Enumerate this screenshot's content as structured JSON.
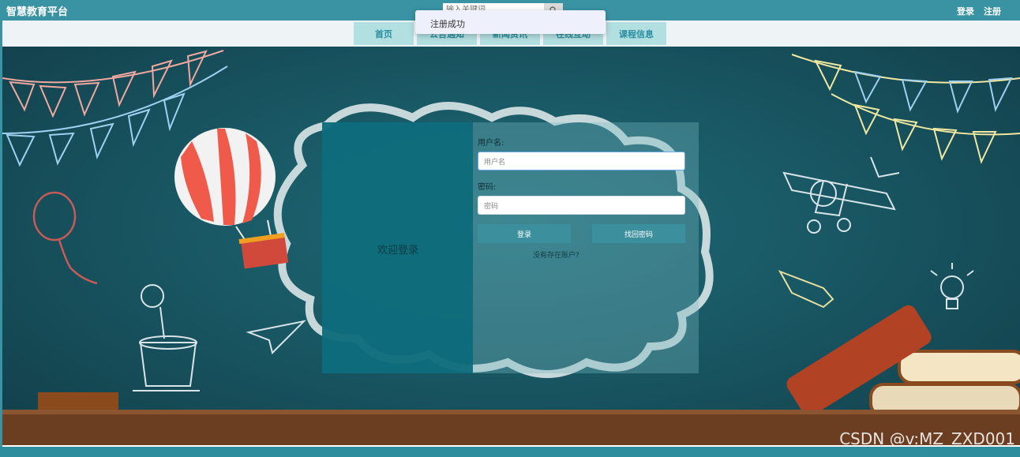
{
  "header": {
    "site_title": "智慧教育平台",
    "search_placeholder": "输入关键词",
    "login": "登录",
    "register": "注册"
  },
  "nav": {
    "items": [
      {
        "label": "首页"
      },
      {
        "label": "公告通知"
      },
      {
        "label": "新闻资讯"
      },
      {
        "label": "在线互动"
      },
      {
        "label": "课程信息"
      }
    ]
  },
  "toast": {
    "message": "注册成功"
  },
  "login": {
    "welcome": "欢迎登录",
    "username_label": "用户名:",
    "username_placeholder": "用户名",
    "password_label": "密码:",
    "password_placeholder": "密码",
    "login_button": "登录",
    "forgot_button": "找回密码",
    "no_account": "没有存在账户?"
  },
  "watermark": "CSDN @v:MZ_ZXD001",
  "colors": {
    "topbar": "#3a93a3",
    "nav_button": "#b2dfe0",
    "login_panel": "#0e6c7c"
  }
}
